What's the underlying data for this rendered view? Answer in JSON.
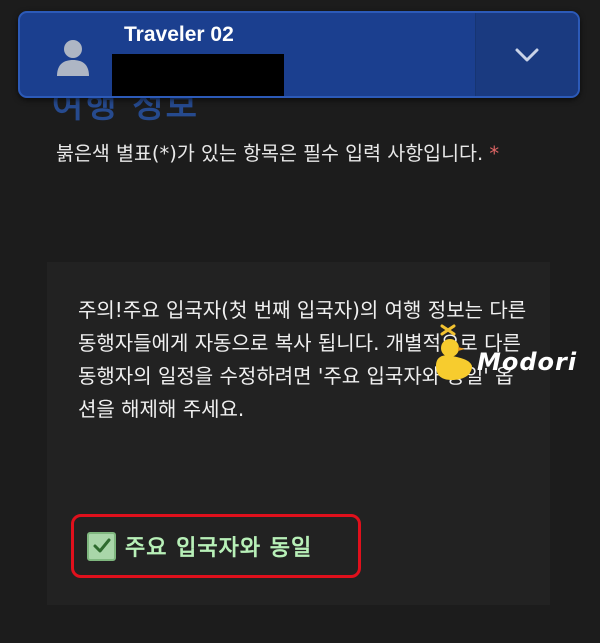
{
  "header": {
    "traveler_name": "Traveler 02"
  },
  "section": {
    "heading": "여행 정보",
    "required_note": "붉은색 별표(*)가 있는 항목은 필수 입력 사항입니다.",
    "required_marker": "*"
  },
  "notice": {
    "text": "주의!주요 입국자(첫 번째 입국자)의 여행 정보는 다른 동행자들에게 자동으로 복사 됩니다. 개별적으로 다른 동행자의 일정을 수정하려면 '주요 입국자와 동일' 옵션을 해제해 주세요.",
    "checkbox_label": "주요 입국자와 동일",
    "checked": true
  },
  "watermark": {
    "text": "Modori"
  }
}
